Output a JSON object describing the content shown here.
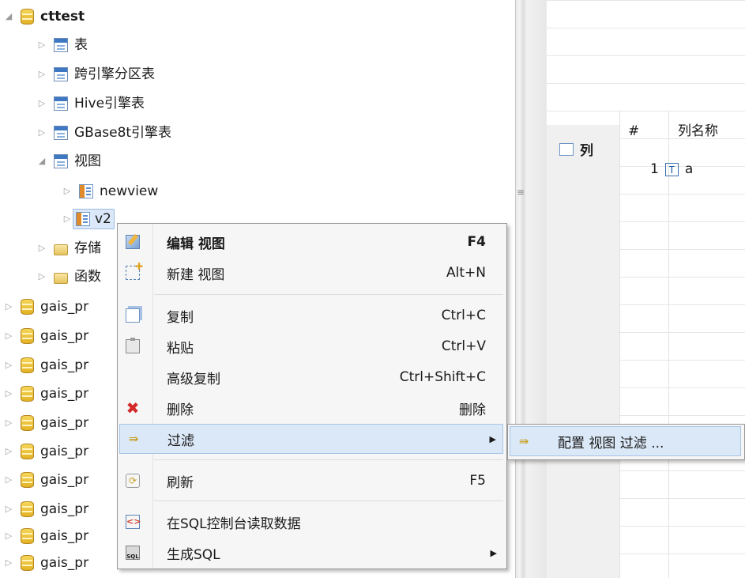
{
  "tree": {
    "root": {
      "label": "cttest",
      "icon": "database-icon",
      "expanded": true
    },
    "items": [
      {
        "label": "表",
        "icon": "table-folder-icon"
      },
      {
        "label": "跨引擎分区表",
        "icon": "table-folder-icon"
      },
      {
        "label": "Hive引擎表",
        "icon": "table-folder-icon"
      },
      {
        "label": "GBase8t引擎表",
        "icon": "table-folder-icon"
      },
      {
        "label": "视图",
        "icon": "view-folder-icon"
      }
    ],
    "views": [
      {
        "label": "newview",
        "icon": "view-icon"
      },
      {
        "label": "v2",
        "icon": "view-icon",
        "selected": true
      }
    ],
    "folders": [
      {
        "label": "存储",
        "icon": "folder-icon"
      },
      {
        "label": "函数",
        "icon": "folder-icon"
      }
    ],
    "databases": [
      "gais_pr",
      "gais_pr",
      "gais_pr",
      "gais_pr",
      "gais_pr",
      "gais_pr",
      "gais_pr",
      "gais_pr",
      "gais_pr",
      "gais_pr"
    ]
  },
  "right_panel": {
    "tab_label": "列",
    "headers": {
      "num": "#",
      "name": "列名称"
    },
    "rows": [
      {
        "num": "1",
        "type": "T",
        "name": "a"
      }
    ]
  },
  "context_menu": {
    "items": [
      {
        "label": "编辑 视图",
        "shortcut": "F4",
        "icon": "edit-icon",
        "bold": true
      },
      {
        "label": "新建 视图",
        "shortcut": "Alt+N",
        "icon": "new-icon"
      },
      {
        "label": "复制",
        "shortcut": "Ctrl+C",
        "icon": "copy-icon"
      },
      {
        "label": "粘贴",
        "shortcut": "Ctrl+V",
        "icon": "paste-icon"
      },
      {
        "label": "高级复制",
        "shortcut": "Ctrl+Shift+C",
        "icon": ""
      },
      {
        "label": "删除",
        "shortcut": "删除",
        "icon": "delete-icon"
      },
      {
        "label": "过滤",
        "shortcut": "",
        "icon": "filter-icon",
        "submenu": true,
        "highlighted": true
      },
      {
        "label": "刷新",
        "shortcut": "F5",
        "icon": "refresh-icon"
      },
      {
        "label": "在SQL控制台读取数据",
        "shortcut": "",
        "icon": "sql-console-icon"
      },
      {
        "label": "生成SQL",
        "shortcut": "",
        "icon": "generate-sql-icon",
        "submenu": true
      }
    ]
  },
  "submenu": {
    "items": [
      {
        "label": "配置 视图 过滤 ...",
        "icon": "filter-icon",
        "highlighted": true
      }
    ]
  }
}
